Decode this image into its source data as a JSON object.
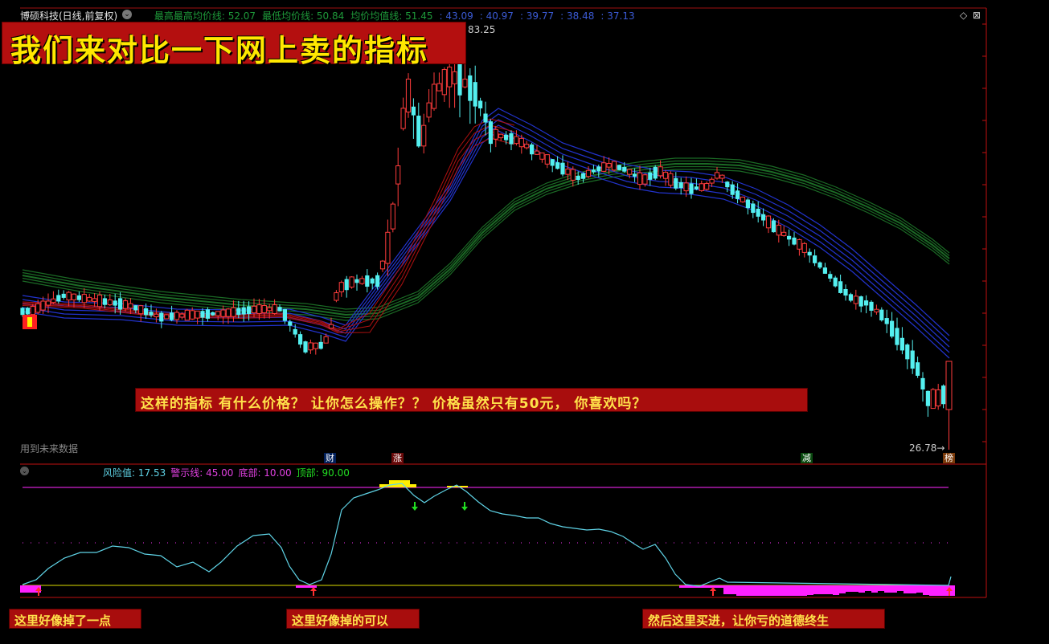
{
  "header": {
    "stock_title": "博硕科技(日线,前复权)",
    "ma_labels": [
      {
        "text": "最高最高均价线: 52.07",
        "color": "#1e9a3a"
      },
      {
        "text": "最低均价线: 50.84",
        "color": "#1e9a3a"
      },
      {
        "text": "均价均值线: 51.45",
        "color": "#1e9a3a"
      },
      {
        "text": ": 43.09",
        "color": "#3b5bd6"
      },
      {
        "text": ": 40.97",
        "color": "#3b5bd6"
      },
      {
        "text": ": 39.77",
        "color": "#3b5bd6"
      },
      {
        "text": ": 38.48",
        "color": "#3b5bd6"
      },
      {
        "text": ": 37.13",
        "color": "#3b5bd6"
      }
    ]
  },
  "banner": {
    "text": "我们来对比一下网上卖的指标"
  },
  "main_chart": {
    "high_label": "83.25",
    "low_label": "26.78",
    "future_data_note": "用到未来数据",
    "markers": {
      "cai": "财",
      "zhang": "涨",
      "jian": "减",
      "bang": "榜"
    }
  },
  "middle_callout": {
    "text": "这样的指标   有什么价格？   让你怎么操作？？   价格虽然只有50元，  你喜欢吗？"
  },
  "indicator": {
    "legend": [
      {
        "text": "风险值: 17.53",
        "color": "#5fd3e6"
      },
      {
        "text": "警示线: 45.00",
        "color": "#e040e0"
      },
      {
        "text": "底部: 10.00",
        "color": "#e040e0"
      },
      {
        "text": "顶部: 90.00",
        "color": "#22dd22"
      }
    ]
  },
  "notes": {
    "note1": "这里好像掉了一点",
    "note2": "这里好像掉的可以",
    "note3": "然后这里买进，让你亏的道德终生"
  },
  "colors": {
    "up_candle": "#ff3c3c",
    "down_candle": "#54f0f0",
    "ma_blue": "#2233cc",
    "ma_red": "#b01010",
    "ma_green": "#1b6a25",
    "risk_line": "#5fd3e6",
    "warning_line": "#d020d0",
    "bottom_bars": "#ff20ff",
    "top_bars": "#ffee00"
  },
  "icons": [
    "chevron-down-icon",
    "diamond-icon",
    "close-icon",
    "buy-arrow-icon",
    "sell-arrow-icon"
  ]
}
